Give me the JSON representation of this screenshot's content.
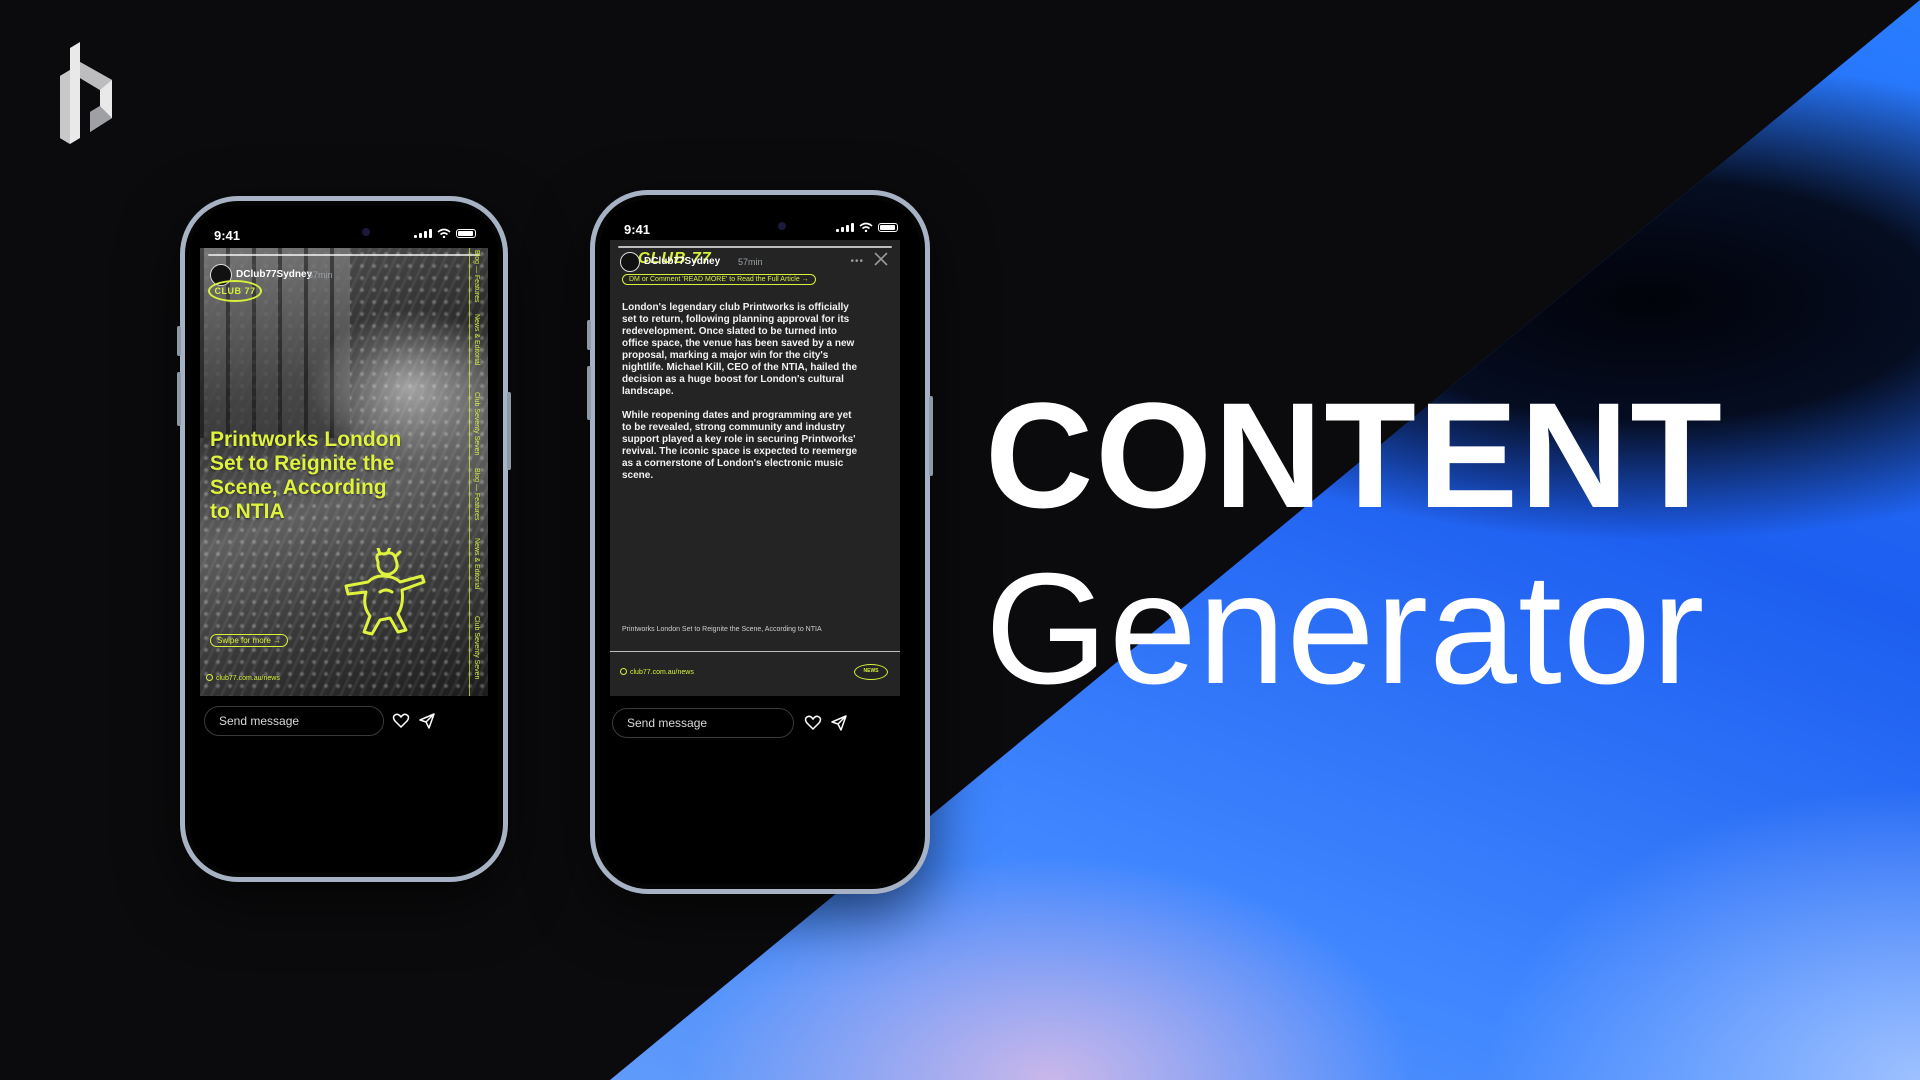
{
  "brand": {
    "logo_icon": "brand-logo-icon"
  },
  "title": {
    "line1": "CONTENT",
    "line2": "Generator"
  },
  "colors": {
    "accent": "#d8f03a",
    "blue": "#2a7dff",
    "background": "#0b0b0d"
  },
  "phone1": {
    "status_time": "9:41",
    "username": "DClub77Sydney",
    "time_ago": "57min",
    "club_badge": "CLUB 77",
    "headline": "Printworks London Set to Reignite the Scene, According to NTIA",
    "side_nav": [
      "Blog — Features",
      "News & Editorial",
      "Club Seventy Seven",
      "Blog — Features",
      "News & Editorial",
      "Club Seventy Seven"
    ],
    "swipe_label": "Swipe for more →",
    "url": "club77.com.au/news",
    "message_placeholder": "Send message"
  },
  "phone2": {
    "status_time": "9:41",
    "club_logo": "CLUB 77",
    "username": "DClub77Sydney",
    "time_ago": "57min",
    "cta": "DM or Comment 'READ MORE' to Read the Full Article →",
    "paragraph1": "London's legendary club Printworks is officially set to return, following planning approval for its redevelopment. Once slated to be turned into office space, the venue has been saved by a new proposal, marking a major win for the city's nightlife. Michael Kill, CEO of the NTIA, hailed the decision as a huge boost for London's cultural landscape.",
    "paragraph2": "While reopening dates and programming are yet to be revealed, strong community and industry support played a key role in securing Printworks' revival. The iconic space is expected to reemerge as a cornerstone of London's electronic music scene.",
    "footer_title": "Printworks London Set to Reignite the Scene, According to NTIA",
    "url": "club77.com.au/news",
    "news_badge": "NEWS",
    "message_placeholder": "Send message"
  }
}
